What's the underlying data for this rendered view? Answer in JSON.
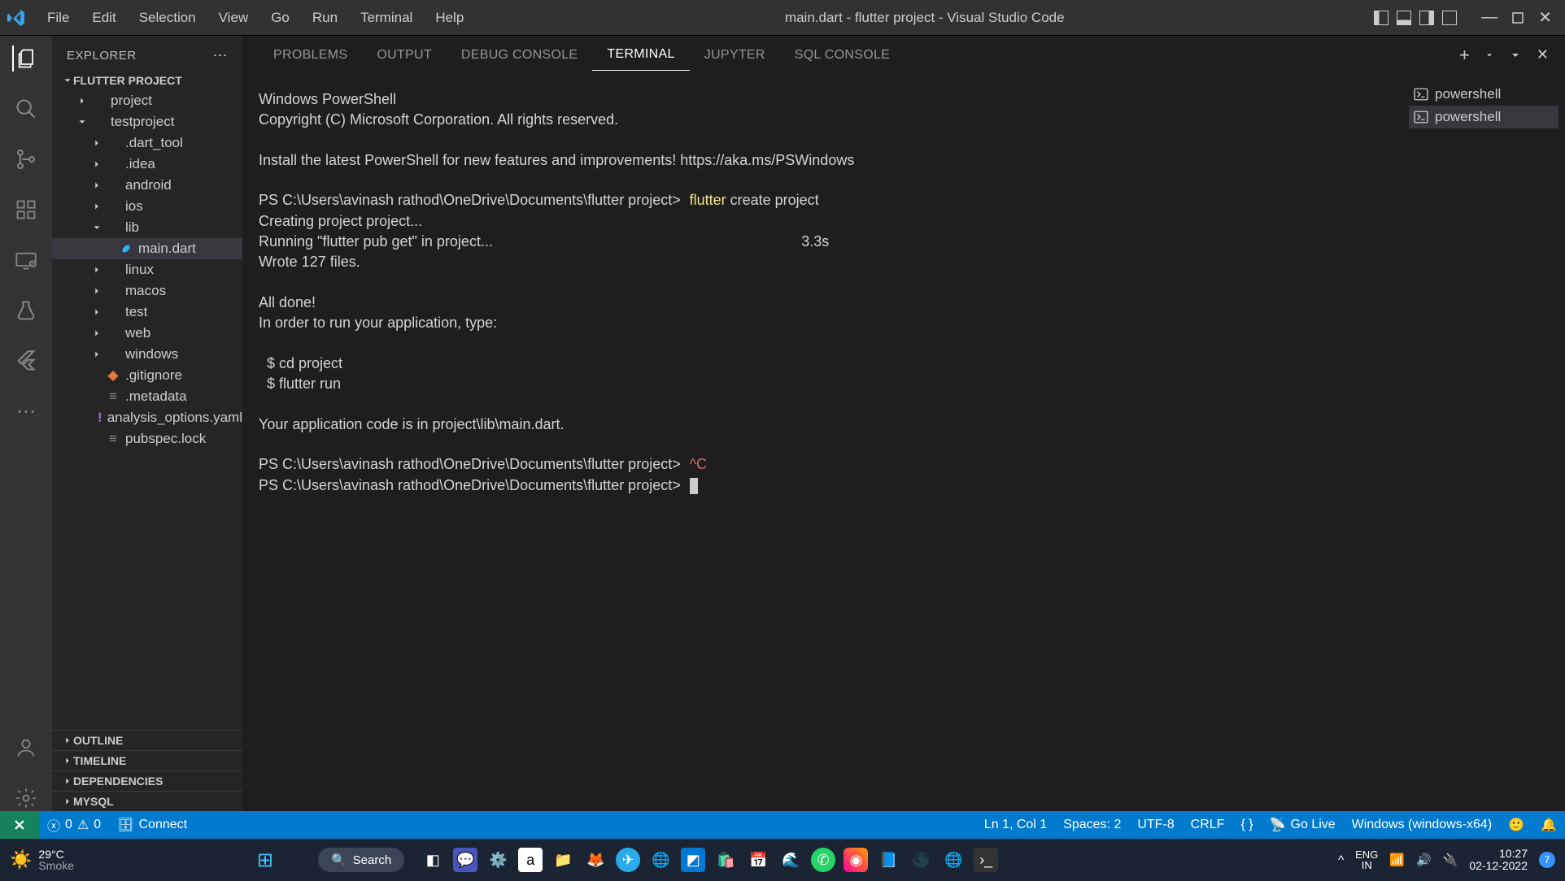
{
  "title": "main.dart - flutter project - Visual Studio Code",
  "menu": [
    "File",
    "Edit",
    "Selection",
    "View",
    "Go",
    "Run",
    "Terminal",
    "Help"
  ],
  "explorer": {
    "header": "EXPLORER",
    "project": "FLUTTER PROJECT",
    "tree": [
      {
        "label": "project",
        "type": "folder",
        "indent": 1,
        "open": false
      },
      {
        "label": "testproject",
        "type": "folder",
        "indent": 1,
        "open": true
      },
      {
        "label": ".dart_tool",
        "type": "folder",
        "indent": 2,
        "open": false
      },
      {
        "label": ".idea",
        "type": "folder",
        "indent": 2,
        "open": false
      },
      {
        "label": "android",
        "type": "folder",
        "indent": 2,
        "open": false
      },
      {
        "label": "ios",
        "type": "folder",
        "indent": 2,
        "open": false
      },
      {
        "label": "lib",
        "type": "folder",
        "indent": 2,
        "open": true
      },
      {
        "label": "main.dart",
        "type": "dart",
        "indent": 3,
        "selected": true
      },
      {
        "label": "linux",
        "type": "folder",
        "indent": 2,
        "open": false
      },
      {
        "label": "macos",
        "type": "folder",
        "indent": 2,
        "open": false
      },
      {
        "label": "test",
        "type": "folder",
        "indent": 2,
        "open": false
      },
      {
        "label": "web",
        "type": "folder",
        "indent": 2,
        "open": false
      },
      {
        "label": "windows",
        "type": "folder",
        "indent": 2,
        "open": false
      },
      {
        "label": ".gitignore",
        "type": "git",
        "indent": 2
      },
      {
        "label": ".metadata",
        "type": "file",
        "indent": 2
      },
      {
        "label": "analysis_options.yaml",
        "type": "yaml",
        "indent": 2
      },
      {
        "label": "pubspec.lock",
        "type": "file",
        "indent": 2
      }
    ],
    "sections": [
      "OUTLINE",
      "TIMELINE",
      "DEPENDENCIES",
      "MYSQL"
    ]
  },
  "panel": {
    "tabs": [
      "PROBLEMS",
      "OUTPUT",
      "DEBUG CONSOLE",
      "TERMINAL",
      "JUPYTER",
      "SQL CONSOLE"
    ],
    "active": "TERMINAL",
    "terminal": {
      "header1": "Windows PowerShell",
      "header2": "Copyright (C) Microsoft Corporation. All rights reserved.",
      "install": "Install the latest PowerShell for new features and improvements! https://aka.ms/PSWindows",
      "prompt": "PS C:\\Users\\avinash rathod\\OneDrive\\Documents\\flutter project>",
      "cmd1": "flutter",
      "cmd1_rest": " create project",
      "l1": "Creating project project...",
      "l2a": "Running \"flutter pub get\" in project...",
      "l2b": "3.3s",
      "l3": "Wrote 127 files.",
      "l4": "All done!",
      "l5": "In order to run your application, type:",
      "l6": "  $ cd project",
      "l7": "  $ flutter run",
      "l8": "Your application code is in project\\lib\\main.dart.",
      "ctrlc": "^C"
    },
    "side": [
      "powershell",
      "powershell"
    ]
  },
  "status": {
    "errors": "0",
    "warnings": "0",
    "connect": "Connect",
    "lncol": "Ln 1, Col 1",
    "spaces": "Spaces: 2",
    "encoding": "UTF-8",
    "eol": "CRLF",
    "golive": "Go Live",
    "target": "Windows (windows-x64)"
  },
  "taskbar": {
    "temp": "29°C",
    "weather": "Smoke",
    "search": "Search",
    "lang1": "ENG",
    "lang2": "IN",
    "time": "10:27",
    "date": "02-12-2022",
    "notif": "7"
  }
}
